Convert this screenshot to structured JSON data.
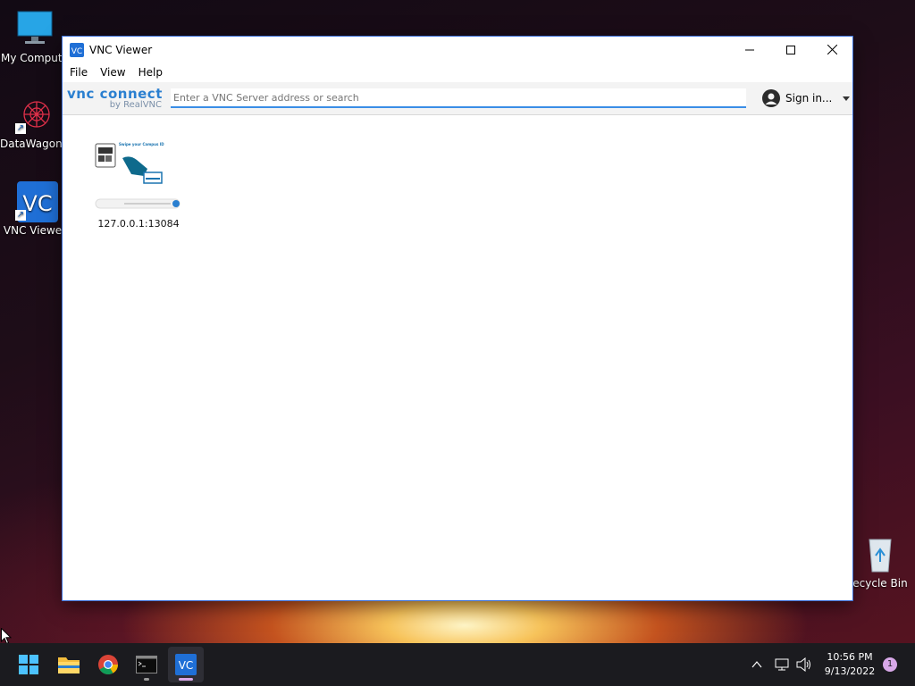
{
  "desktop": {
    "icons": [
      {
        "label": "My Compute",
        "icon": "monitor-icon"
      },
      {
        "label": "DataWagon...",
        "icon": "datawagon-icon"
      },
      {
        "label": "VNC Viewer",
        "icon": "vnc-viewer-icon"
      },
      {
        "label": "ecycle Bin",
        "icon": "recycle-bin-icon"
      }
    ]
  },
  "window": {
    "title": "VNC Viewer",
    "menu": [
      "File",
      "View",
      "Help"
    ],
    "logo": {
      "brand": "vnc connect",
      "sub": "by RealVNC"
    },
    "search_placeholder": "Enter a VNC Server address or search",
    "sign_in": "Sign in...",
    "connections": [
      {
        "label": "127.0.0.1:13084",
        "thumbnail_text": "Swipe your Campus ID"
      }
    ]
  },
  "taskbar": {
    "apps": [
      "start-icon",
      "file-explorer-icon",
      "chrome-icon",
      "terminal-icon",
      "vnc-viewer-icon"
    ],
    "active_app": "vnc-viewer-icon",
    "time": "10:56 PM",
    "date": "9/13/2022",
    "notifications": "1"
  },
  "colors": {
    "accent": "#3a8ee6",
    "vnc_blue": "#1f6fd6",
    "taskbar": "#1b1b1f"
  }
}
